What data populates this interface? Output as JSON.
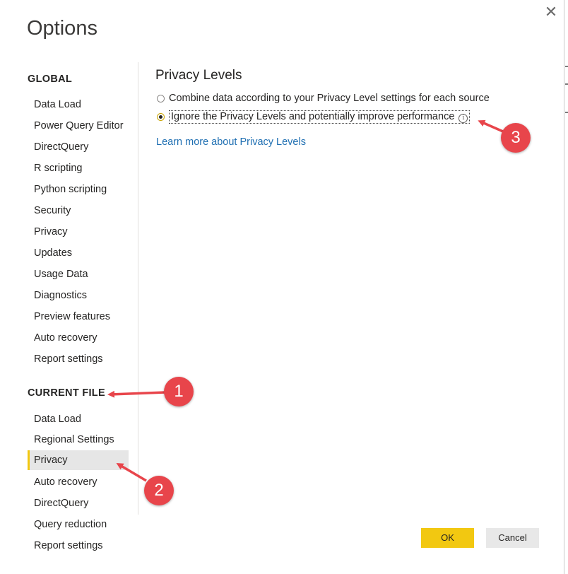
{
  "dialog": {
    "title": "Options",
    "close_glyph": "✕"
  },
  "sidebar": {
    "global_heading": "GLOBAL",
    "global_items": [
      "Data Load",
      "Power Query Editor",
      "DirectQuery",
      "R scripting",
      "Python scripting",
      "Security",
      "Privacy",
      "Updates",
      "Usage Data",
      "Diagnostics",
      "Preview features",
      "Auto recovery",
      "Report settings"
    ],
    "current_file_heading": "CURRENT FILE",
    "current_file_items": [
      "Data Load",
      "Regional Settings",
      "Privacy",
      "Auto recovery",
      "DirectQuery",
      "Query reduction",
      "Report settings"
    ],
    "selected_item": "Privacy"
  },
  "content": {
    "heading": "Privacy Levels",
    "option1_label": "Combine data according to your Privacy Level settings for each source",
    "option2_label": "Ignore the Privacy Levels and potentially improve performance",
    "option2_checked": true,
    "info_glyph": "i",
    "learn_more_link": "Learn more about Privacy Levels"
  },
  "buttons": {
    "ok_label": "OK",
    "cancel_label": "Cancel"
  },
  "annotations": {
    "callout1": "1",
    "callout2": "2",
    "callout3": "3",
    "color": "#e8454b"
  },
  "colors": {
    "accent": "#f2c811",
    "link": "#1f6fb2"
  }
}
